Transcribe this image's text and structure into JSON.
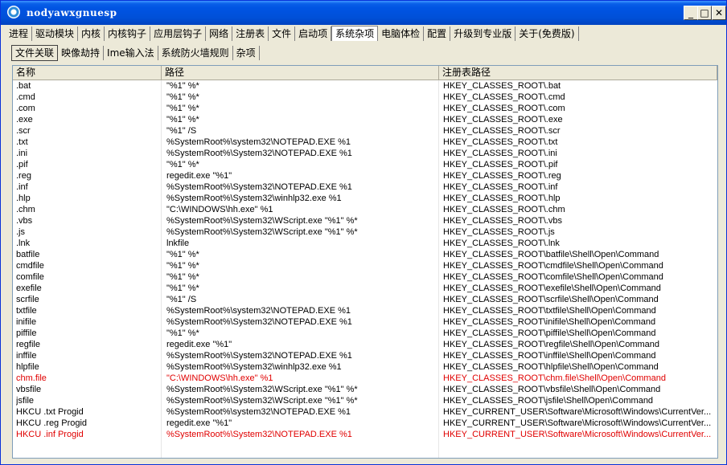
{
  "window": {
    "title": "nodyawxgnuesp"
  },
  "main_tabs": [
    "进程",
    "驱动模块",
    "内核",
    "内核钩子",
    "应用层钩子",
    "网络",
    "注册表",
    "文件",
    "启动项",
    "系统杂项",
    "电脑体检",
    "配置",
    "升级到专业版",
    "关于(免费版)"
  ],
  "main_tab_active": 9,
  "sub_tabs": [
    "文件关联",
    "映像劫持",
    "Ime输入法",
    "系统防火墙规则",
    "杂项"
  ],
  "sub_tab_active": 0,
  "columns": [
    "名称",
    "路径",
    "注册表路径"
  ],
  "rows": [
    {
      "name": ".bat",
      "path": "\"%1\" %*",
      "reg": "HKEY_CLASSES_ROOT\\.bat",
      "red": false
    },
    {
      "name": ".cmd",
      "path": "\"%1\" %*",
      "reg": "HKEY_CLASSES_ROOT\\.cmd",
      "red": false
    },
    {
      "name": ".com",
      "path": "\"%1\" %*",
      "reg": "HKEY_CLASSES_ROOT\\.com",
      "red": false
    },
    {
      "name": ".exe",
      "path": "\"%1\" %*",
      "reg": "HKEY_CLASSES_ROOT\\.exe",
      "red": false
    },
    {
      "name": ".scr",
      "path": "\"%1\" /S",
      "reg": "HKEY_CLASSES_ROOT\\.scr",
      "red": false
    },
    {
      "name": ".txt",
      "path": "%SystemRoot%\\system32\\NOTEPAD.EXE %1",
      "reg": "HKEY_CLASSES_ROOT\\.txt",
      "red": false
    },
    {
      "name": ".ini",
      "path": "%SystemRoot%\\System32\\NOTEPAD.EXE %1",
      "reg": "HKEY_CLASSES_ROOT\\.ini",
      "red": false
    },
    {
      "name": ".pif",
      "path": "\"%1\" %*",
      "reg": "HKEY_CLASSES_ROOT\\.pif",
      "red": false
    },
    {
      "name": ".reg",
      "path": "regedit.exe \"%1\"",
      "reg": "HKEY_CLASSES_ROOT\\.reg",
      "red": false
    },
    {
      "name": ".inf",
      "path": "%SystemRoot%\\System32\\NOTEPAD.EXE %1",
      "reg": "HKEY_CLASSES_ROOT\\.inf",
      "red": false
    },
    {
      "name": ".hlp",
      "path": "%SystemRoot%\\System32\\winhlp32.exe %1",
      "reg": "HKEY_CLASSES_ROOT\\.hlp",
      "red": false
    },
    {
      "name": ".chm",
      "path": "\"C:\\WINDOWS\\hh.exe\" %1",
      "reg": "HKEY_CLASSES_ROOT\\.chm",
      "red": false
    },
    {
      "name": ".vbs",
      "path": "%SystemRoot%\\System32\\WScript.exe \"%1\" %*",
      "reg": "HKEY_CLASSES_ROOT\\.vbs",
      "red": false
    },
    {
      "name": ".js",
      "path": "%SystemRoot%\\System32\\WScript.exe \"%1\" %*",
      "reg": "HKEY_CLASSES_ROOT\\.js",
      "red": false
    },
    {
      "name": ".lnk",
      "path": "lnkfile",
      "reg": "HKEY_CLASSES_ROOT\\.lnk",
      "red": false
    },
    {
      "name": "batfile",
      "path": "\"%1\" %*",
      "reg": "HKEY_CLASSES_ROOT\\batfile\\Shell\\Open\\Command",
      "red": false
    },
    {
      "name": "cmdfile",
      "path": "\"%1\" %*",
      "reg": "HKEY_CLASSES_ROOT\\cmdfile\\Shell\\Open\\Command",
      "red": false
    },
    {
      "name": "comfile",
      "path": "\"%1\" %*",
      "reg": "HKEY_CLASSES_ROOT\\comfile\\Shell\\Open\\Command",
      "red": false
    },
    {
      "name": "exefile",
      "path": "\"%1\" %*",
      "reg": "HKEY_CLASSES_ROOT\\exefile\\Shell\\Open\\Command",
      "red": false
    },
    {
      "name": "scrfile",
      "path": "\"%1\" /S",
      "reg": "HKEY_CLASSES_ROOT\\scrfile\\Shell\\Open\\Command",
      "red": false
    },
    {
      "name": "txtfile",
      "path": "%SystemRoot%\\system32\\NOTEPAD.EXE %1",
      "reg": "HKEY_CLASSES_ROOT\\txtfile\\Shell\\Open\\Command",
      "red": false
    },
    {
      "name": "inifile",
      "path": "%SystemRoot%\\System32\\NOTEPAD.EXE %1",
      "reg": "HKEY_CLASSES_ROOT\\inifile\\Shell\\Open\\Command",
      "red": false
    },
    {
      "name": "piffile",
      "path": "\"%1\" %*",
      "reg": "HKEY_CLASSES_ROOT\\piffile\\Shell\\Open\\Command",
      "red": false
    },
    {
      "name": "regfile",
      "path": "regedit.exe \"%1\"",
      "reg": "HKEY_CLASSES_ROOT\\regfile\\Shell\\Open\\Command",
      "red": false
    },
    {
      "name": "inffile",
      "path": "%SystemRoot%\\System32\\NOTEPAD.EXE %1",
      "reg": "HKEY_CLASSES_ROOT\\inffile\\Shell\\Open\\Command",
      "red": false
    },
    {
      "name": "hlpfile",
      "path": "%SystemRoot%\\System32\\winhlp32.exe %1",
      "reg": "HKEY_CLASSES_ROOT\\hlpfile\\Shell\\Open\\Command",
      "red": false
    },
    {
      "name": "chm.file",
      "path": "\"C:\\WINDOWS\\hh.exe\" %1",
      "reg": "HKEY_CLASSES_ROOT\\chm.file\\Shell\\Open\\Command",
      "red": true
    },
    {
      "name": "vbsfile",
      "path": "%SystemRoot%\\System32\\WScript.exe \"%1\" %*",
      "reg": "HKEY_CLASSES_ROOT\\vbsfile\\Shell\\Open\\Command",
      "red": false
    },
    {
      "name": "jsfile",
      "path": "%SystemRoot%\\System32\\WScript.exe \"%1\" %*",
      "reg": "HKEY_CLASSES_ROOT\\jsfile\\Shell\\Open\\Command",
      "red": false
    },
    {
      "name": "HKCU .txt Progid",
      "path": "%SystemRoot%\\system32\\NOTEPAD.EXE %1",
      "reg": "HKEY_CURRENT_USER\\Software\\Microsoft\\Windows\\CurrentVer...",
      "red": false
    },
    {
      "name": "HKCU .reg Progid",
      "path": "regedit.exe \"%1\"",
      "reg": "HKEY_CURRENT_USER\\Software\\Microsoft\\Windows\\CurrentVer...",
      "red": false
    },
    {
      "name": "HKCU .inf Progid",
      "path": "%SystemRoot%\\System32\\NOTEPAD.EXE %1",
      "reg": "HKEY_CURRENT_USER\\Software\\Microsoft\\Windows\\CurrentVer...",
      "red": true
    }
  ],
  "colors": {
    "title_bar": "#0054e3",
    "highlight_red": "#e00000"
  }
}
